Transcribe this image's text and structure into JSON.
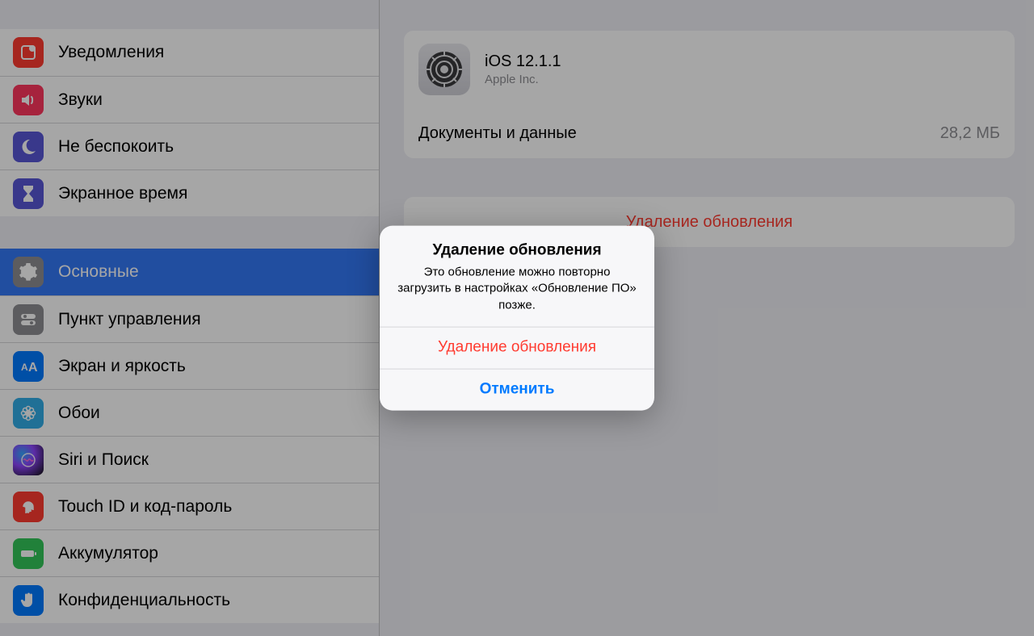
{
  "sidebar": {
    "items": [
      {
        "label": "Уведомления"
      },
      {
        "label": "Звуки"
      },
      {
        "label": "Не беспокоить"
      },
      {
        "label": "Экранное время"
      },
      {
        "label": "Основные"
      },
      {
        "label": "Пункт управления"
      },
      {
        "label": "Экран и яркость"
      },
      {
        "label": "Обои"
      },
      {
        "label": "Siri и Поиск"
      },
      {
        "label": "Touch ID и код-пароль"
      },
      {
        "label": "Аккумулятор"
      },
      {
        "label": "Конфиденциальность"
      }
    ]
  },
  "detail": {
    "update": {
      "title": "iOS 12.1.1",
      "vendor": "Apple Inc."
    },
    "docs": {
      "label": "Документы и данные",
      "value": "28,2 МБ"
    },
    "delete_label": "Удаление обновления"
  },
  "alert": {
    "title": "Удаление обновления",
    "message": "Это обновление можно повторно загрузить в настройках «Обновление ПО» позже.",
    "destructive": "Удаление обновления",
    "cancel": "Отменить"
  }
}
